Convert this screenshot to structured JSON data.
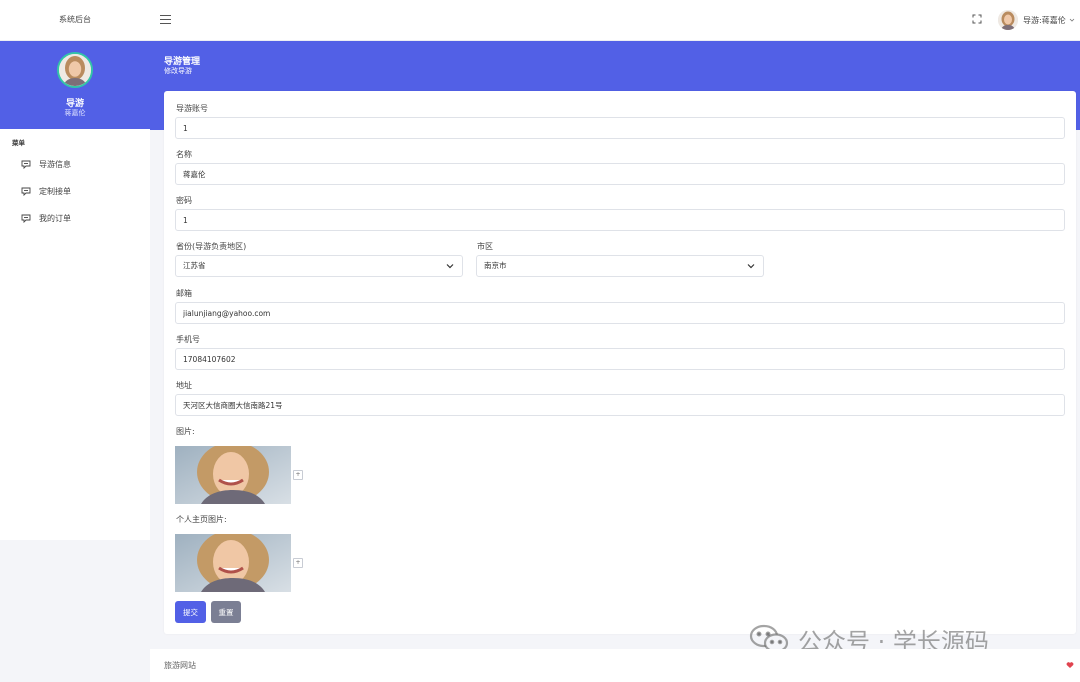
{
  "header": {
    "brand": "系统后台",
    "user_label": "导游:蒋嘉伦"
  },
  "sidebar": {
    "role": "导游",
    "name": "蒋嘉伦",
    "menu_title": "菜单",
    "items": [
      {
        "label": "导游信息",
        "icon": "message-icon"
      },
      {
        "label": "定制接单",
        "icon": "message-icon"
      },
      {
        "label": "我的订单",
        "icon": "message-icon"
      }
    ]
  },
  "page": {
    "title": "导游管理",
    "subtitle": "修改导游"
  },
  "form": {
    "account": {
      "label": "导游账号",
      "value": "1"
    },
    "name": {
      "label": "名称",
      "value": "蒋嘉伦"
    },
    "password": {
      "label": "密码",
      "value": "1"
    },
    "province": {
      "label": "省份(导游负责地区)",
      "value": "江苏省"
    },
    "city": {
      "label": "市区",
      "value": "南京市"
    },
    "email": {
      "label": "邮箱",
      "value": "jialunjiang@yahoo.com"
    },
    "phone": {
      "label": "手机号",
      "value": "17084107602"
    },
    "address": {
      "label": "地址",
      "value": "天河区大信商圈大信南路21号"
    },
    "image": {
      "label": "图片:"
    },
    "homepage_image": {
      "label": "个人主页图片:"
    },
    "plus": "+",
    "submit": "提交",
    "reset": "重置"
  },
  "footer": {
    "text": "旅游网站"
  },
  "watermark": {
    "text": "公众号 · 学长源码"
  },
  "colors": {
    "primary": "#5260e6",
    "accent_ring": "#33c5a8",
    "reset_button": "#7b7f94",
    "heart": "#e0434f"
  }
}
